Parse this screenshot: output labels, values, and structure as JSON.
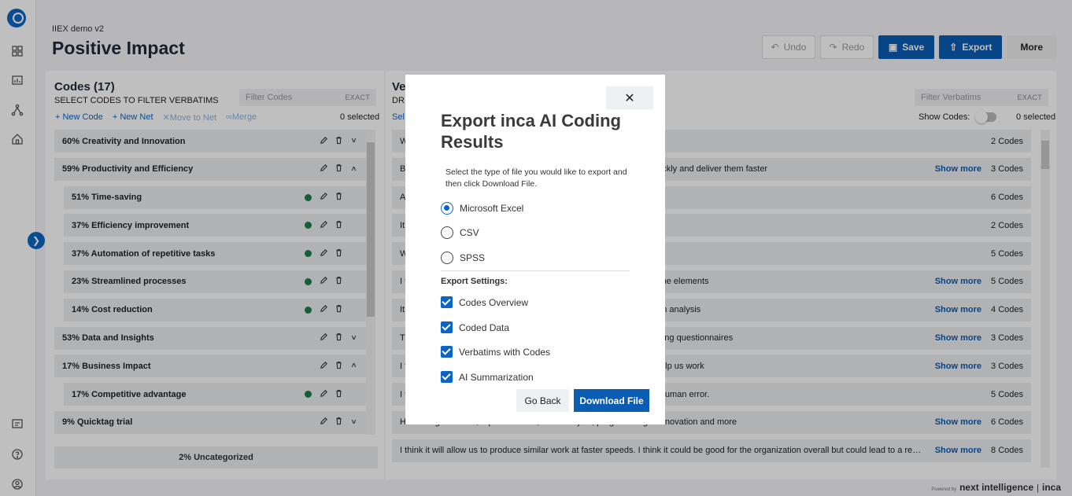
{
  "header": {
    "project": "IIEX demo v2",
    "title": "Positive Impact",
    "undo": "Undo",
    "redo": "Redo",
    "save": "Save",
    "export": "Export",
    "more": "More"
  },
  "codes": {
    "title": "Codes (17)",
    "subtitle": "SELECT CODES TO FILTER VERBATIMS",
    "filter_placeholder": "Filter Codes",
    "exact": "EXACT",
    "new_code": "New Code",
    "new_net": "New Net",
    "move_to_net": "Move to Net",
    "merge": "Merge",
    "selected": "0 selected",
    "items": [
      {
        "label": "60% Creativity and Innovation",
        "sub": false,
        "expanded": false
      },
      {
        "label": "59% Productivity and Efficiency",
        "sub": false,
        "expanded": true
      },
      {
        "label": "51% Time-saving",
        "sub": true
      },
      {
        "label": "37% Efficiency improvement",
        "sub": true
      },
      {
        "label": "37% Automation of repetitive tasks",
        "sub": true
      },
      {
        "label": "23% Streamlined processes",
        "sub": true
      },
      {
        "label": "14% Cost reduction",
        "sub": true
      },
      {
        "label": "53% Data and Insights",
        "sub": false,
        "expanded": false
      },
      {
        "label": "17% Business Impact",
        "sub": false,
        "expanded": true
      },
      {
        "label": "17% Competitive advantage",
        "sub": true
      },
      {
        "label": "9% Quicktag trial",
        "sub": false,
        "expanded": false
      }
    ],
    "uncategorized": "2% Uncategorized"
  },
  "verbatims": {
    "title": "Ve",
    "subtitle": "DR",
    "select_partial": "Sel",
    "filter_placeholder": "Filter Verbatims",
    "exact": "EXACT",
    "show_codes": "Show Codes:",
    "selected": "0 selected",
    "show_more": "Show more",
    "rows": [
      {
        "text": "W",
        "more": false,
        "codes": "2 Codes"
      },
      {
        "text": "Be                                                                                           fearful of what the impact; It will allow us to get answers more quickly and deliver them faster",
        "more": true,
        "codes": "3 Codes"
      },
      {
        "text": "Al                                                                                           et. Other people are figuring this out",
        "more": false,
        "codes": "6 Codes"
      },
      {
        "text": "It                                                                                            erfaces for all our internal knowledge and learning materials",
        "more": false,
        "codes": "2 Codes"
      },
      {
        "text": "W                                                                                           hole range of things, auto transcription, summarising etc",
        "more": false,
        "codes": "5 Codes"
      },
      {
        "text": "I t                                                                                            e delivery faster and cheaper.; I think it may come handy to do some elements",
        "more": true,
        "codes": "5 Codes"
      },
      {
        "text": "It                                                                                            n be put more to BD, client relationshipmanagement, deep research analysis",
        "more": true,
        "codes": "4 Codes"
      },
      {
        "text": "Th                                                                                           d how much.; Open ended responses, content development, making questionnaires",
        "more": true,
        "codes": "3 Codes"
      },
      {
        "text": "I t                                                                                            pectives, find structures that we haven't seen before. It can also help us work",
        "more": true,
        "codes": "3 Codes"
      },
      {
        "text": "I t                                                                                            aster = cheaper = happy clients. ; Cut out human processing and human error.",
        "more": false,
        "codes": "5 Codes"
      },
      {
        "text": "H                                                                                            ontent generation, report creation, data analysis, programming & innovation and more",
        "more": true,
        "codes": "6 Codes"
      },
      {
        "text": "I think it will allow us to produce similar work at faster speeds. I think it could be good for the organization overall but could lead to a reduced headcount",
        "more": true,
        "codes": "8 Codes"
      }
    ]
  },
  "footer": {
    "powered": "Powered by",
    "brand1": "next intelligence",
    "brand2": "inca"
  },
  "modal": {
    "close": "✕",
    "title": "Export inca AI Coding Results",
    "description": "Select the type of file you would like to export and then click Download File.",
    "formats": [
      {
        "label": "Microsoft Excel",
        "selected": true
      },
      {
        "label": "CSV",
        "selected": false
      },
      {
        "label": "SPSS",
        "selected": false
      }
    ],
    "settings_label": "Export Settings:",
    "settings": [
      {
        "label": "Codes Overview",
        "checked": true
      },
      {
        "label": "Coded Data",
        "checked": true
      },
      {
        "label": "Verbatims with Codes",
        "checked": true
      },
      {
        "label": "AI Summarization",
        "checked": true
      }
    ],
    "go_back": "Go Back",
    "download": "Download File"
  },
  "colors": {
    "accent": "#0b5cb3",
    "dot": "#1a7f4b"
  }
}
